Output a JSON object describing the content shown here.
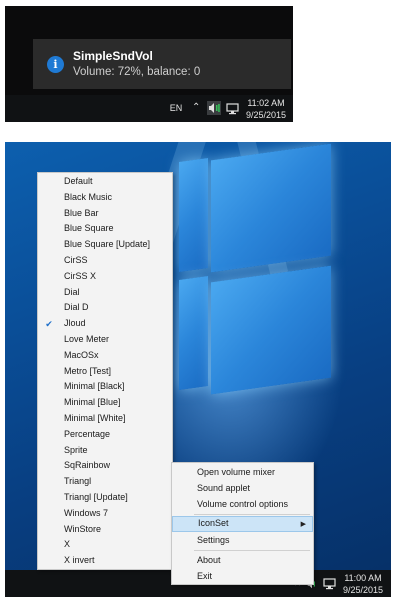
{
  "notification": {
    "title": "SimpleSndVol",
    "body": "Volume: 72%, balance: 0",
    "icon": "info-icon"
  },
  "top_taskbar": {
    "language": "EN",
    "chevron": "^",
    "time": "11:02 AM",
    "date": "9/25/2015"
  },
  "bottom_taskbar": {
    "time": "11:00 AM",
    "date": "9/25/2015"
  },
  "iconset_menu": {
    "checked_item": "Jloud",
    "items": [
      "Default",
      "Black Music",
      "Blue Bar",
      "Blue Square",
      "Blue Square [Update]",
      "CirSS",
      "CirSS X",
      "Dial",
      "Dial D",
      "Jloud",
      "Love Meter",
      "MacOSx",
      "Metro [Test]",
      "Minimal [Black]",
      "Minimal [Blue]",
      "Minimal [White]",
      "Percentage",
      "Sprite",
      "SqRainbow",
      "Triangl",
      "Triangl [Update]",
      "Windows 7",
      "WinStore",
      "X",
      "X invert"
    ]
  },
  "context_menu": {
    "open_mixer": "Open volume mixer",
    "sound_applet": "Sound applet",
    "volume_options": "Volume control options",
    "iconset": "IconSet",
    "settings": "Settings",
    "about": "About",
    "exit": "Exit",
    "submenu_arrow": "▶"
  },
  "colors": {
    "accent": "#1f7ad4",
    "highlight": "#cce4f7"
  }
}
